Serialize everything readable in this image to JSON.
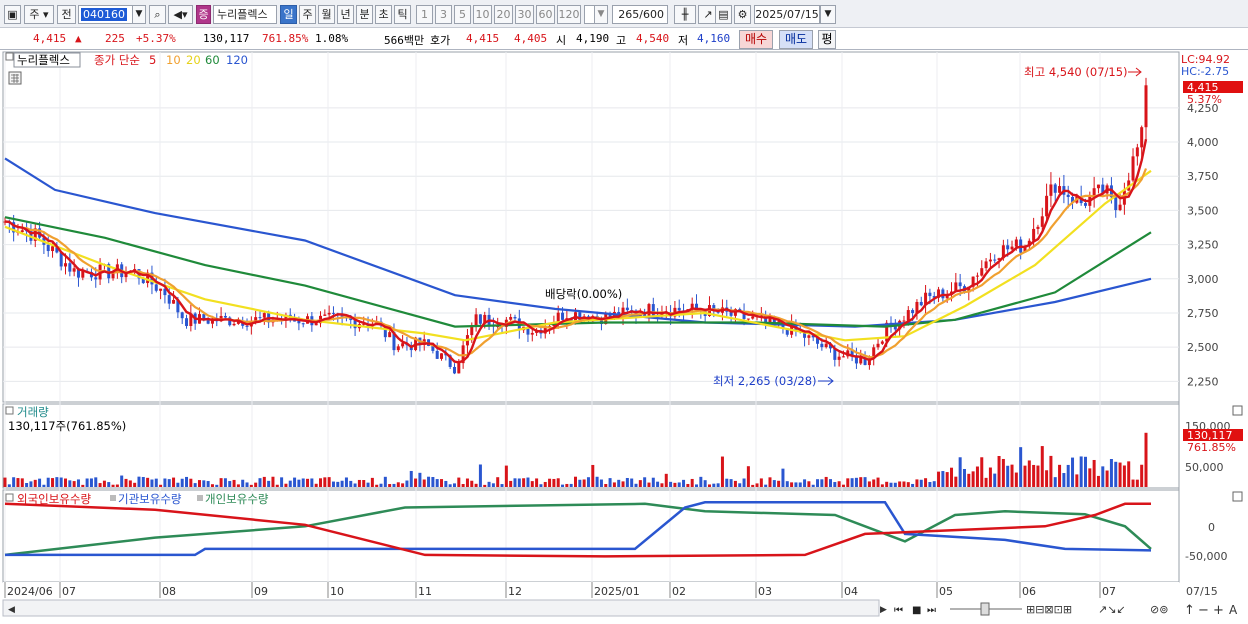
{
  "toolbar": {
    "market_label": "주",
    "prev_label": "전",
    "code": "040160",
    "indicator_badge": "증",
    "stock_name": "누리플렉스",
    "periods": [
      "일",
      "주",
      "월",
      "년",
      "분",
      "초",
      "틱"
    ],
    "active_period": "일",
    "intervals": [
      "1",
      "3",
      "5",
      "10",
      "20",
      "30",
      "60",
      "120"
    ],
    "count_current": "265",
    "count_total": "/600",
    "date": "2025/07/15"
  },
  "quote": {
    "price": "4,415",
    "change_arrow": "▲",
    "change": "225",
    "change_pct": "+5.37%",
    "volume": "130,117",
    "volume_ratio": "761.85%",
    "turnover_pct": "1.08%",
    "amount": "566백만",
    "bid_ask_label": "호가",
    "ask": "4,415",
    "bid": "4,405",
    "open_label": "시",
    "open": "4,190",
    "high_label": "고",
    "high": "4,540",
    "low_label": "저",
    "low": "4,160",
    "buy_label": "매수",
    "sell_label": "매도",
    "eval_label": "평"
  },
  "price_panel": {
    "legend_name": "누리플렉스",
    "legend_ma_title": "종가 단순",
    "ma_periods": [
      "5",
      "10",
      "20",
      "60",
      "120"
    ],
    "ma_colors": [
      "#d8141a",
      "#f0a030",
      "#f2e020",
      "#1f8a3a",
      "#2a56d0"
    ],
    "lc_label": "LC:94.92",
    "hc_label": "HC:-2.75",
    "last_price_tag": "4,415",
    "last_pct_tag": "5.37%",
    "high_annotation": "최고 4,540 (07/15)",
    "low_annotation": "최저 2,265 (03/28)",
    "dividend_annotation": "배당락(0.00%)",
    "y_ticks": [
      "4,250",
      "4,000",
      "3,750",
      "3,500",
      "3,250",
      "3,000",
      "2,750",
      "2,500",
      "2,250"
    ]
  },
  "volume_panel": {
    "title": "거래량",
    "subtitle": "130,117주(761.85%)",
    "last_tag": "130,117",
    "last_pct_tag": "761.85%",
    "y_ticks": [
      "150,000",
      "50,000"
    ]
  },
  "holdings_panel": {
    "legend": [
      "외국인보유수량",
      "기관보유수량",
      "개인보유수량"
    ],
    "colors": [
      "#d8141a",
      "#2a56d0",
      "#2e8b57"
    ],
    "y_ticks": [
      "0",
      "-50,000"
    ]
  },
  "x_axis": {
    "labels": [
      "2024/06",
      "07",
      "08",
      "09",
      "10",
      "11",
      "12",
      "2025/01",
      "02",
      "03",
      "04",
      "05",
      "06",
      "07"
    ],
    "right_label": "07/15"
  },
  "chart_data": {
    "type": "candlestick",
    "title": "누리플렉스",
    "y_range": [
      2150,
      4600
    ],
    "high": 4540,
    "low": 2265,
    "last": 4415,
    "price_path": [
      [
        0,
        3420
      ],
      [
        30,
        3320
      ],
      [
        70,
        3050
      ],
      [
        130,
        3050
      ],
      [
        160,
        2900
      ],
      [
        180,
        2700
      ],
      [
        230,
        2700
      ],
      [
        290,
        2700
      ],
      [
        330,
        2700
      ],
      [
        370,
        2680
      ],
      [
        390,
        2520
      ],
      [
        420,
        2520
      ],
      [
        450,
        2350
      ],
      [
        470,
        2700
      ],
      [
        500,
        2700
      ],
      [
        530,
        2620
      ],
      [
        560,
        2750
      ],
      [
        600,
        2720
      ],
      [
        650,
        2780
      ],
      [
        700,
        2770
      ],
      [
        750,
        2700
      ],
      [
        790,
        2620
      ],
      [
        830,
        2450
      ],
      [
        860,
        2400
      ],
      [
        880,
        2620
      ],
      [
        920,
        2850
      ],
      [
        960,
        2950
      ],
      [
        990,
        3200
      ],
      [
        1020,
        3250
      ],
      [
        1050,
        3700
      ],
      [
        1075,
        3550
      ],
      [
        1100,
        3650
      ],
      [
        1110,
        3500
      ],
      [
        1125,
        3800
      ],
      [
        1140,
        4100
      ],
      [
        1146,
        4415
      ]
    ],
    "ma120_path": [
      [
        0,
        3880
      ],
      [
        50,
        3650
      ],
      [
        150,
        3480
      ],
      [
        300,
        3280
      ],
      [
        450,
        2880
      ],
      [
        550,
        2780
      ],
      [
        700,
        2680
      ],
      [
        850,
        2650
      ],
      [
        950,
        2700
      ],
      [
        1050,
        2830
      ],
      [
        1146,
        3000
      ]
    ],
    "ma60_path": [
      [
        0,
        3450
      ],
      [
        100,
        3300
      ],
      [
        200,
        3100
      ],
      [
        300,
        2950
      ],
      [
        450,
        2650
      ],
      [
        600,
        2680
      ],
      [
        750,
        2680
      ],
      [
        880,
        2650
      ],
      [
        950,
        2700
      ],
      [
        1050,
        2900
      ],
      [
        1146,
        3340
      ]
    ],
    "ma20_path": [
      [
        0,
        3380
      ],
      [
        100,
        3100
      ],
      [
        200,
        2850
      ],
      [
        300,
        2700
      ],
      [
        420,
        2600
      ],
      [
        460,
        2550
      ],
      [
        550,
        2680
      ],
      [
        700,
        2750
      ],
      [
        840,
        2550
      ],
      [
        900,
        2580
      ],
      [
        960,
        2800
      ],
      [
        1030,
        3100
      ],
      [
        1100,
        3550
      ],
      [
        1146,
        3790
      ]
    ],
    "volume_max": 180000,
    "volume_last": 130117,
    "holdings_range": [
      -80000,
      25000
    ]
  }
}
